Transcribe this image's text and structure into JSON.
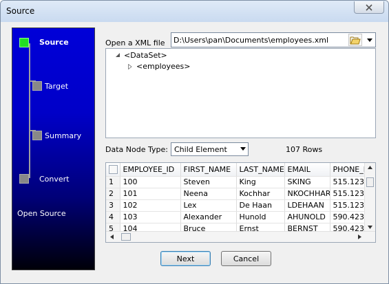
{
  "window": {
    "title": "Source"
  },
  "wizard": {
    "steps": [
      {
        "label": "Source",
        "active": true
      },
      {
        "label": "Target",
        "active": false
      },
      {
        "label": "Summary",
        "active": false
      },
      {
        "label": "Convert",
        "active": false
      }
    ],
    "hint": "Open Source",
    "active_color": "#22dd22"
  },
  "xml_file": {
    "label": "Open a XML file",
    "path": "D:\\Users\\pan\\Documents\\employees.xml"
  },
  "tree": {
    "root": "<DataSet>",
    "child": "<employees>"
  },
  "data_node": {
    "label": "Data Node Type:",
    "value": "Child Element",
    "row_count": "107 Rows"
  },
  "grid": {
    "columns": [
      "EMPLOYEE_ID",
      "FIRST_NAME",
      "LAST_NAME",
      "EMAIL",
      "PHONE_I"
    ],
    "rows": [
      {
        "num": "1",
        "cells": [
          "100",
          "Steven",
          "King",
          "SKING",
          "515.123"
        ]
      },
      {
        "num": "2",
        "cells": [
          "101",
          "Neena",
          "Kochhar",
          "NKOCHHAR",
          "515.123"
        ]
      },
      {
        "num": "3",
        "cells": [
          "102",
          "Lex",
          "De Haan",
          "LDEHAAN",
          "515.123"
        ]
      },
      {
        "num": "4",
        "cells": [
          "103",
          "Alexander",
          "Hunold",
          "AHUNOLD",
          "590.423"
        ]
      },
      {
        "num": "5",
        "cells": [
          "104",
          "Bruce",
          "Ernst",
          "BERNST",
          "590.423"
        ]
      }
    ]
  },
  "buttons": {
    "next": "Next",
    "cancel": "Cancel"
  }
}
